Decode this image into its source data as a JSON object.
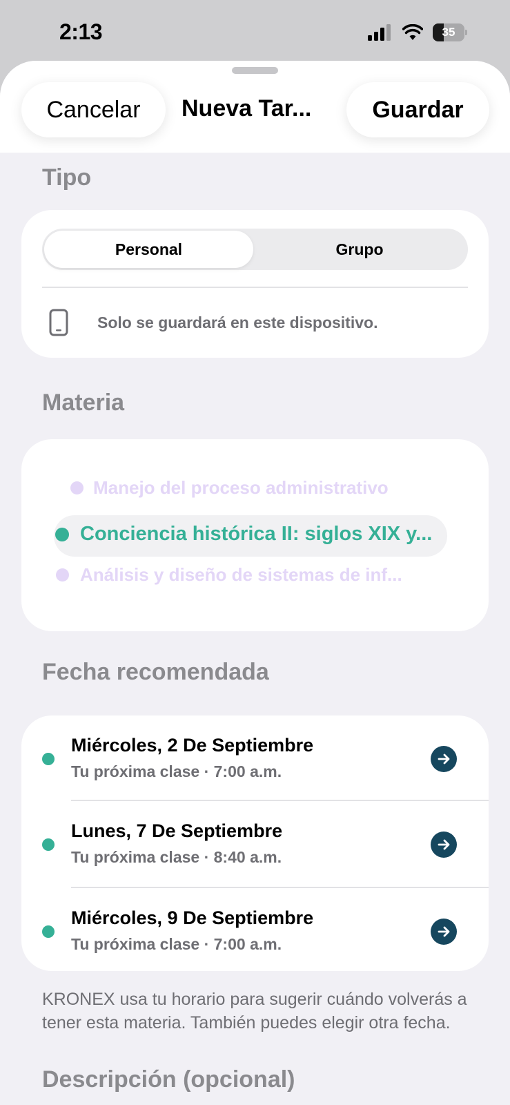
{
  "status_bar": {
    "time": "2:13",
    "battery": "35",
    "battery_level": 0.35
  },
  "header": {
    "cancel_label": "Cancelar",
    "title": "Nueva Tar...",
    "save_label": "Guardar"
  },
  "tipo": {
    "title": "Tipo",
    "options": [
      "Personal",
      "Grupo"
    ],
    "selected": "Personal",
    "note": "Solo se guardará en este dispositivo.",
    "note_icon": "phone-icon"
  },
  "materia": {
    "title": "Materia",
    "items": [
      {
        "label": "Manejo del proceso administrativo",
        "color": "#e3d6f7"
      },
      {
        "label": "Conciencia histórica II: siglos XIX y...",
        "color": "#35b096",
        "selected": true
      },
      {
        "label": "Análisis y diseño de sistemas de inf...",
        "color": "#e3d6f7"
      }
    ]
  },
  "fecha": {
    "title": "Fecha recomendada",
    "items": [
      {
        "date": "Miércoles, 2 De Septiembre",
        "sub": "Tu próxima clase · 7:00 a.m."
      },
      {
        "date": "Lunes, 7 De Septiembre",
        "sub": "Tu próxima clase · 8:40 a.m."
      },
      {
        "date": "Miércoles, 9 De Septiembre",
        "sub": "Tu próxima clase · 7:00 a.m."
      }
    ],
    "dot_color": "#35b096",
    "arrow_color": "#16475e",
    "footnote": "KRONEX usa tu horario para sugerir cuándo volverás a tener esta materia. También puedes elegir otra fecha."
  },
  "descripcion": {
    "title": "Descripción (opcional)"
  }
}
